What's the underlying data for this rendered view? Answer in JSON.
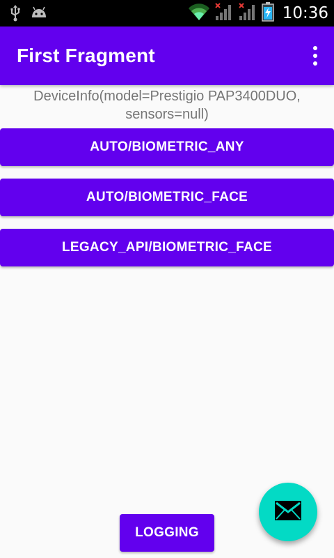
{
  "status_bar": {
    "time": "10:36",
    "icons": [
      "usb-icon",
      "android-icon",
      "wifi-icon",
      "signal-no-service-icon",
      "signal-no-service-icon",
      "battery-charging-icon"
    ]
  },
  "app_bar": {
    "title": "First Fragment",
    "overflow_icon": "more-vert-icon"
  },
  "main": {
    "device_info": "DeviceInfo(model=Prestigio PAP3400DUO, sensors=null)",
    "buttons": [
      {
        "label": "AUTO/BIOMETRIC_ANY"
      },
      {
        "label": "AUTO/BIOMETRIC_FACE"
      },
      {
        "label": "LEGACY_API/BIOMETRIC_FACE"
      }
    ],
    "logging_label": "LOGGING"
  },
  "fab": {
    "icon": "email-icon"
  },
  "colors": {
    "primary": "#6200ee",
    "accent": "#03dac5",
    "background": "#fafafa",
    "status_bar": "#000000"
  }
}
